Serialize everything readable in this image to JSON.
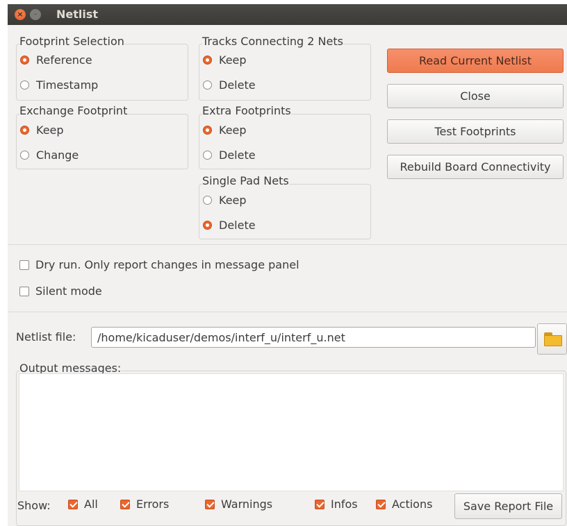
{
  "window": {
    "title": "Netlist"
  },
  "footprint_selection": {
    "label": "Footprint Selection",
    "options": [
      {
        "label": "Reference",
        "selected": true
      },
      {
        "label": "Timestamp",
        "selected": false
      }
    ]
  },
  "exchange_footprint": {
    "label": "Exchange Footprint",
    "options": [
      {
        "label": "Keep",
        "selected": true
      },
      {
        "label": "Change",
        "selected": false
      }
    ]
  },
  "tracks_connecting": {
    "label": "Tracks Connecting 2 Nets",
    "options": [
      {
        "label": "Keep",
        "selected": true
      },
      {
        "label": "Delete",
        "selected": false
      }
    ]
  },
  "extra_footprints": {
    "label": "Extra Footprints",
    "options": [
      {
        "label": "Keep",
        "selected": true
      },
      {
        "label": "Delete",
        "selected": false
      }
    ]
  },
  "single_pad_nets": {
    "label": "Single Pad Nets",
    "options": [
      {
        "label": "Keep",
        "selected": false
      },
      {
        "label": "Delete",
        "selected": true
      }
    ]
  },
  "buttons": {
    "read_netlist": "Read Current Netlist",
    "close": "Close",
    "test_footprints": "Test Footprints",
    "rebuild": "Rebuild Board Connectivity",
    "save_report": "Save Report File"
  },
  "options": {
    "dry_run": {
      "label": "Dry run. Only report changes in message panel",
      "checked": false
    },
    "silent_mode": {
      "label": "Silent mode",
      "checked": false
    }
  },
  "netlist_file": {
    "label": "Netlist file:",
    "value": "/home/kicaduser/demos/interf_u/interf_u.net"
  },
  "output": {
    "label": "Output messages:"
  },
  "show": {
    "label": "Show:",
    "filters": [
      {
        "label": "All",
        "checked": true
      },
      {
        "label": "Errors",
        "checked": true
      },
      {
        "label": "Warnings",
        "checked": true
      },
      {
        "label": "Infos",
        "checked": true
      },
      {
        "label": "Actions",
        "checked": true
      }
    ]
  },
  "colors": {
    "accent": "#e9672e",
    "titlebar": "#3d3c38",
    "dialog_bg": "#f2f1f0"
  }
}
